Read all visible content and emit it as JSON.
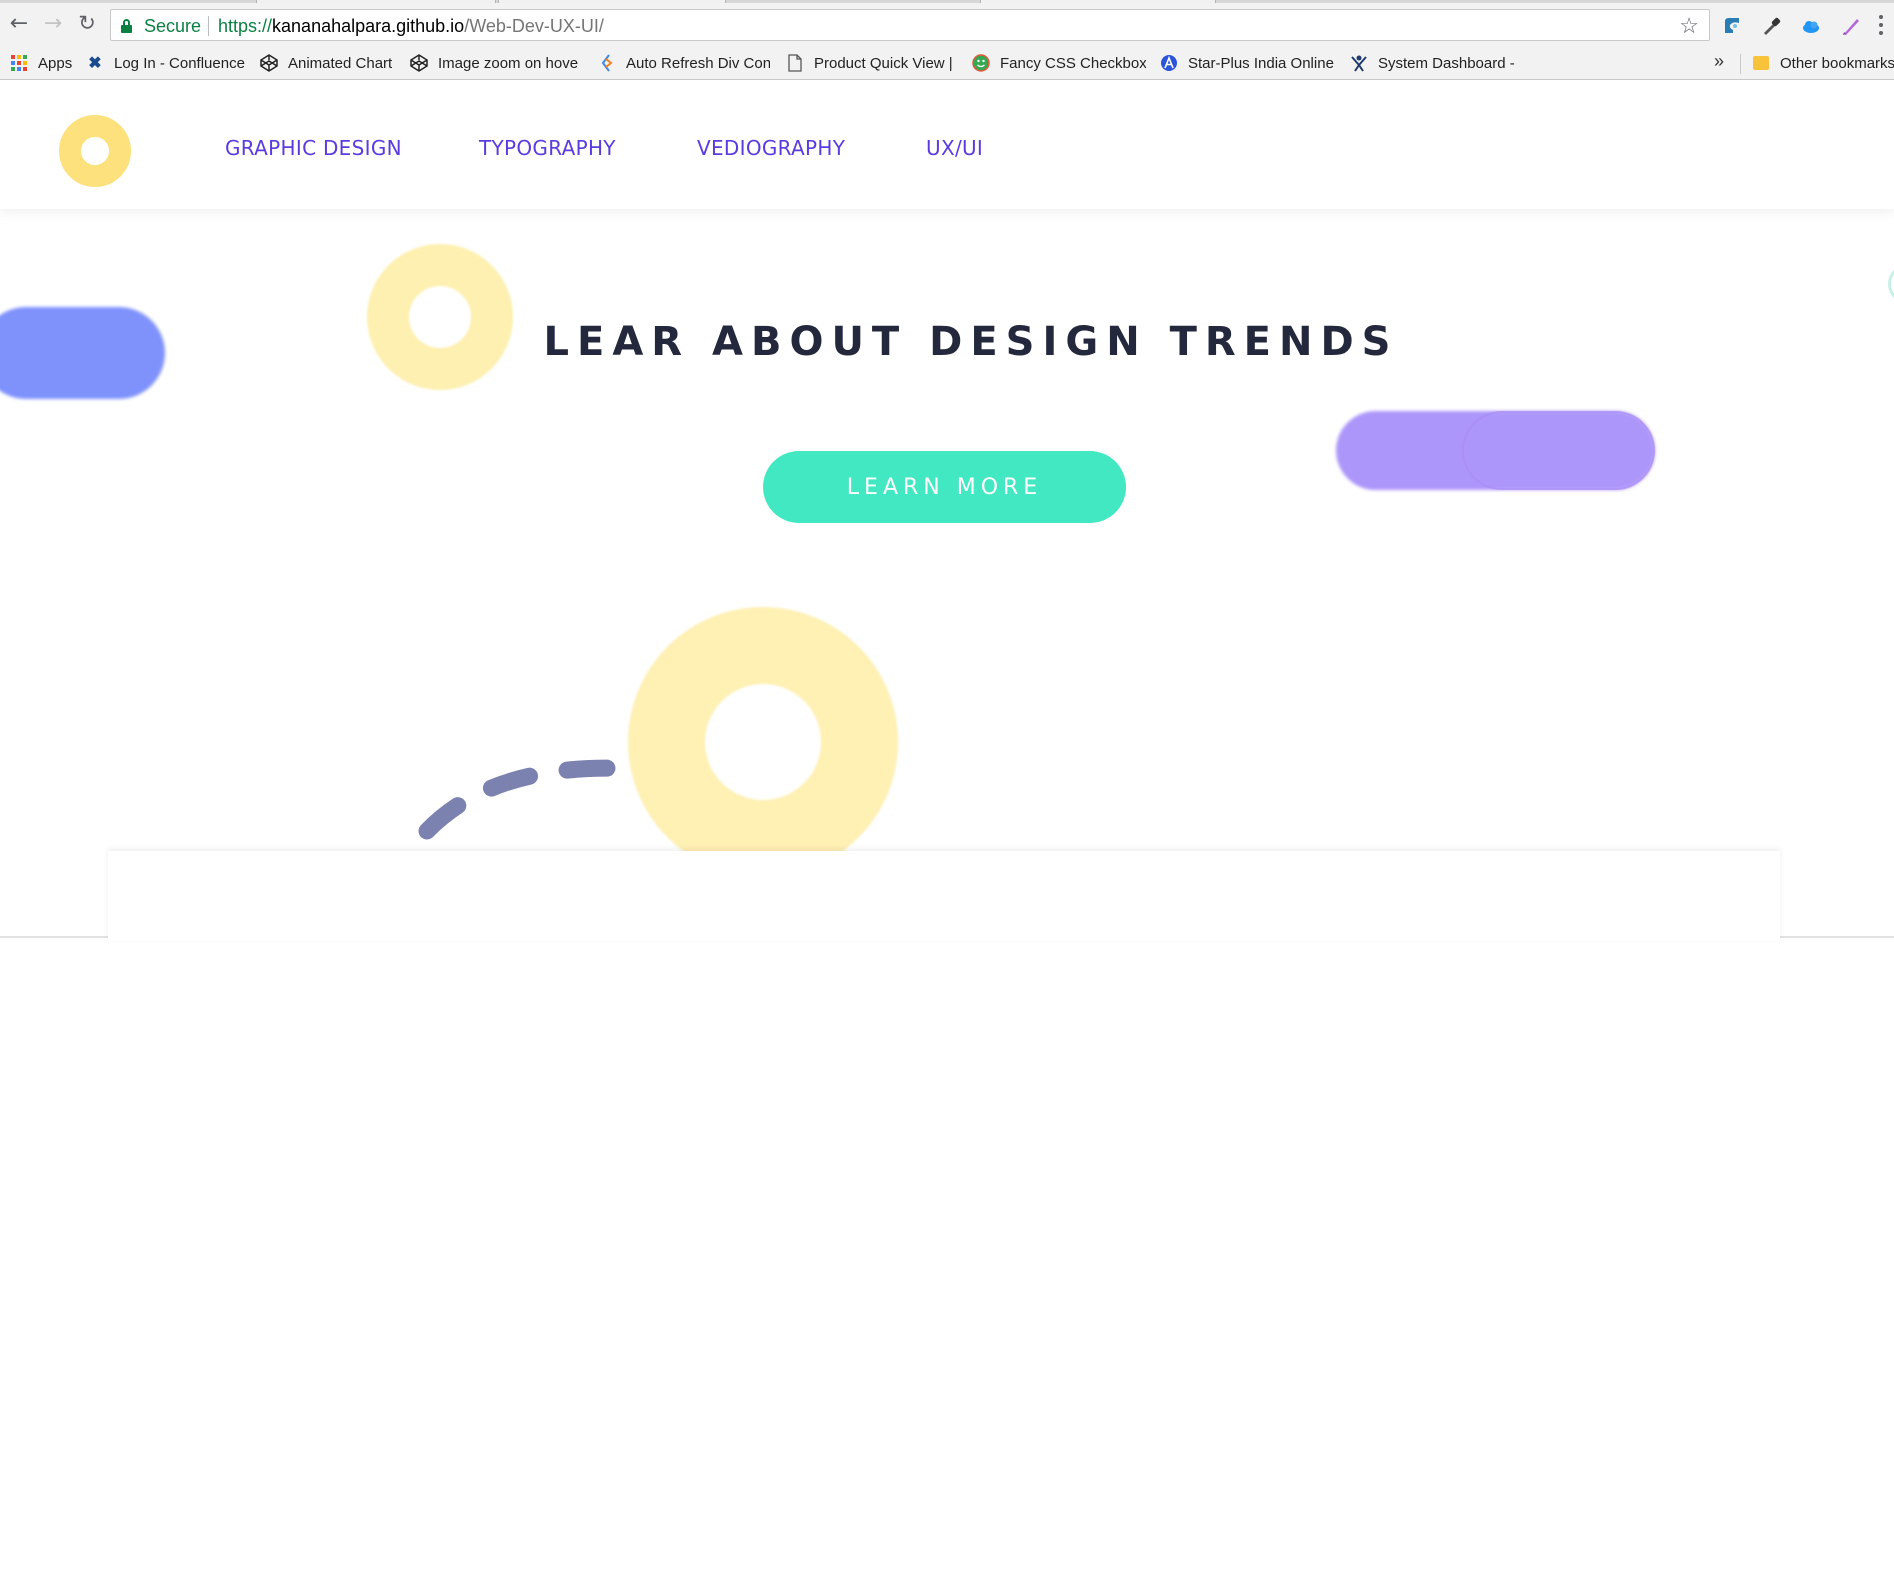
{
  "browser": {
    "back_icon": "arrow-left-icon",
    "forward_icon": "arrow-right-icon",
    "reload_icon": "reload-icon",
    "omnibox": {
      "secure_label": "Secure",
      "url_scheme": "https://",
      "url_host": "kananahalpara.github.io",
      "url_path": "/Web-Dev-UX-UI/",
      "bookmark_star_icon": "star-icon"
    },
    "extensions": [
      "cookie-extension-icon",
      "eyedropper-extension-icon",
      "cloud-extension-icon",
      "pen-extension-icon"
    ],
    "bookmarks": [
      {
        "label": "Apps",
        "icon": "apps-grid-icon"
      },
      {
        "label": "Log In - Confluence",
        "icon": "confluence-icon"
      },
      {
        "label": "Animated Chart",
        "icon": "codepen-icon"
      },
      {
        "label": "Image zoom on hove",
        "icon": "codepen-icon"
      },
      {
        "label": "Auto Refresh Div Con",
        "icon": "stackoverflow-icon"
      },
      {
        "label": "Product Quick View |",
        "icon": "page-icon"
      },
      {
        "label": "Fancy CSS Checkboxe",
        "icon": "smiley-icon"
      },
      {
        "label": "Star-Plus India Online",
        "icon": "star-plus-icon"
      },
      {
        "label": "System Dashboard - ",
        "icon": "jira-icon"
      }
    ],
    "overflow_label": "»",
    "other_bookmarks_label": "Other bookmarks"
  },
  "site": {
    "nav": [
      "GRAPHIC DESIGN",
      "TYPOGRAPHY",
      "VEDIOGRAPHY",
      "UX/UI"
    ],
    "hero_title": "LEAR ABOUT DESIGN TRENDS",
    "cta_label": "LEARN MORE"
  },
  "colors": {
    "nav_link": "#5b3be0",
    "logo_ring": "#fde17c",
    "cta_bg": "#42e8c2",
    "title": "#23283d",
    "pill_blue": "#7f92fc",
    "pill_purple": "#ad96fa",
    "ring_yellow": "#fff0b4",
    "dash": "#7c82b0"
  }
}
